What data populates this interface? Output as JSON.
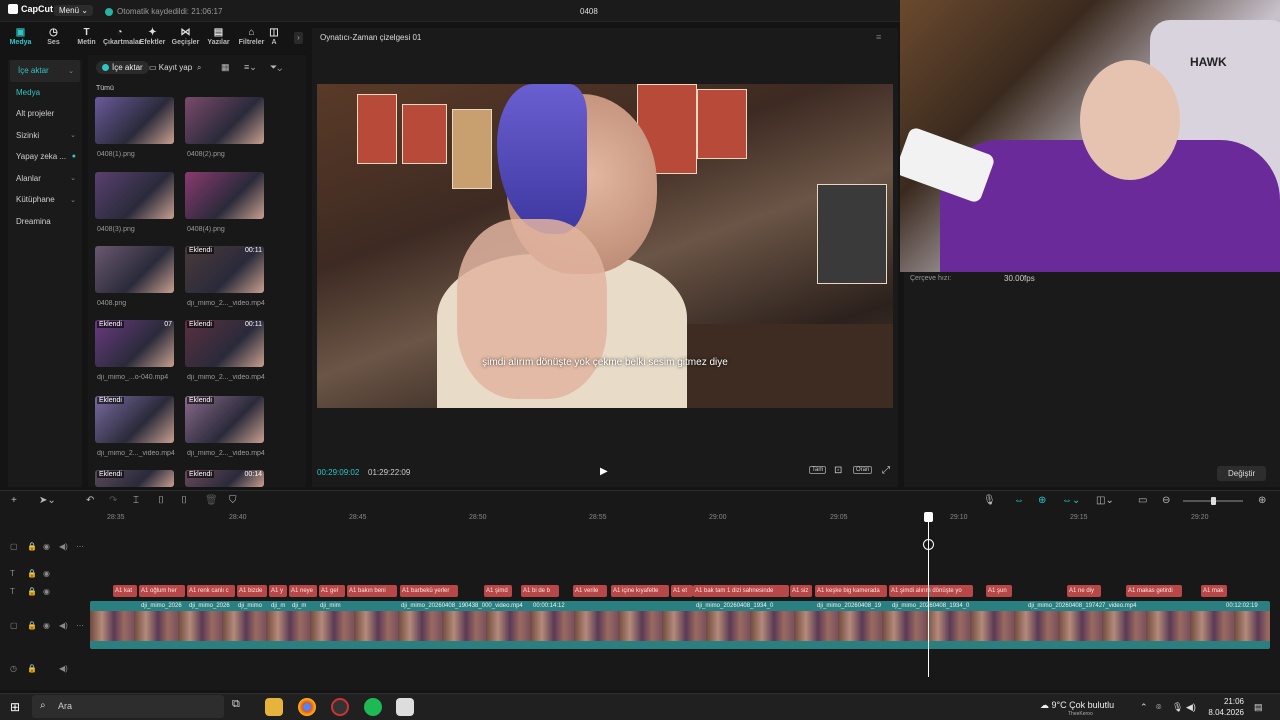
{
  "titlebar": {
    "logo": "CapCut",
    "menu": "Menü",
    "autosave": "Otomatik kaydedildi: 21:06:17",
    "project": "0408"
  },
  "toolbar": [
    {
      "label": "Medya",
      "icon": "media-icon"
    },
    {
      "label": "Ses",
      "icon": "audio-icon"
    },
    {
      "label": "Metin",
      "icon": "text-icon"
    },
    {
      "label": "Çıkartmalar",
      "icon": "sticker-icon"
    },
    {
      "label": "Efektler",
      "icon": "effects-icon"
    },
    {
      "label": "Geçişler",
      "icon": "transitions-icon"
    },
    {
      "label": "Yazılar",
      "icon": "captions-icon"
    },
    {
      "label": "Filtreler",
      "icon": "filters-icon"
    },
    {
      "label": "A",
      "icon": "adjust-icon"
    }
  ],
  "leftnav": [
    "İçe aktar",
    "Medya",
    "Alt projeler",
    "Sizinki",
    "Yapay zeka ...",
    "Alanlar",
    "Kütüphane",
    "Dreamina"
  ],
  "media": {
    "import": "İçe aktar",
    "record": "Kayıt yap",
    "all": "Tümü",
    "items": [
      {
        "name": "0408(1).png",
        "badge": "",
        "dur": ""
      },
      {
        "name": "0408(2).png",
        "badge": "",
        "dur": ""
      },
      {
        "name": "0408(3).png",
        "badge": "",
        "dur": ""
      },
      {
        "name": "0408(4).png",
        "badge": "",
        "dur": ""
      },
      {
        "name": "0408.png",
        "badge": "",
        "dur": ""
      },
      {
        "name": "dji_mimo_2..._video.mp4",
        "badge": "Eklendi",
        "dur": "00:11"
      },
      {
        "name": "dji_mimo_...o-040.mp4",
        "badge": "Eklendi",
        "dur": "07"
      },
      {
        "name": "dji_mimo_2..._video.mp4",
        "badge": "Eklendi",
        "dur": "00:11"
      },
      {
        "name": "dji_mimo_2..._video.mp4",
        "badge": "Eklendi",
        "dur": ""
      },
      {
        "name": "dji_mimo_2..._video.mp4",
        "badge": "Eklendi",
        "dur": ""
      },
      {
        "name": "",
        "badge": "Eklendi",
        "dur": ""
      },
      {
        "name": "",
        "badge": "Eklendi",
        "dur": "00:14"
      }
    ]
  },
  "player": {
    "title": "Oynatıcı-Zaman çizelgesi 01",
    "subtitle": "şimdi alırım dönüşte yok çekme belki sesim gitmez diye",
    "current": "00:29:09:02",
    "total": "01:29:22:09",
    "full_label": "Tam",
    "ratio_label": "Oran"
  },
  "details": {
    "frame_rate_label": "Çerçeve hızı:",
    "frame_rate_value": "30.00fps",
    "change": "Değiştir"
  },
  "webcam": {
    "chair_text": "HAWK"
  },
  "timeline": {
    "ticks": [
      "28:35",
      "28:40",
      "28:45",
      "28:50",
      "28:55",
      "29:00",
      "29:05",
      "29:10",
      "29:15",
      "29:20"
    ],
    "text_clips": [
      "A1 kat",
      "A1 oğlum her",
      "A1 renk canlı c",
      "A1 bizde",
      "A1 y",
      "A1 neye",
      "A1 gel",
      "A1 bakın beni",
      "A1 barbekü yerler",
      "A1 şimd",
      "A1 bi de b",
      "A1 verile",
      "A1 içine kıyafetle",
      "A1 et",
      "A1 bak tam 1 dizi sahnesinde",
      "A1 siz",
      "A1 keşke big kamerada",
      "A1 şimdi alırım dönüşte yo",
      "A1 şun",
      "A1 ne diy",
      "A1 makas getirdi",
      "A1 mak"
    ],
    "video_labels": [
      "dji_mimo_2026",
      "dji_mimo_2026",
      "dji_mimo",
      "dji_m",
      "dji_m",
      "dji_mim",
      "dji_mimo_20260408_190438_000_video.mp4",
      "00:00:14:12",
      "dji_mimo_20260408_1934_0",
      "dji_mimo_20260408_19",
      "dji_mimo_20260408_1934_0",
      "dji_mimo_20260408_197427_video.mp4",
      "00:12:02:19"
    ]
  },
  "taskbar": {
    "search": "Ara",
    "weather": "9°C  Çok bulutlu",
    "weather_sub": "TheeKeroo",
    "time": "21:06",
    "date": "8.04.2026"
  }
}
